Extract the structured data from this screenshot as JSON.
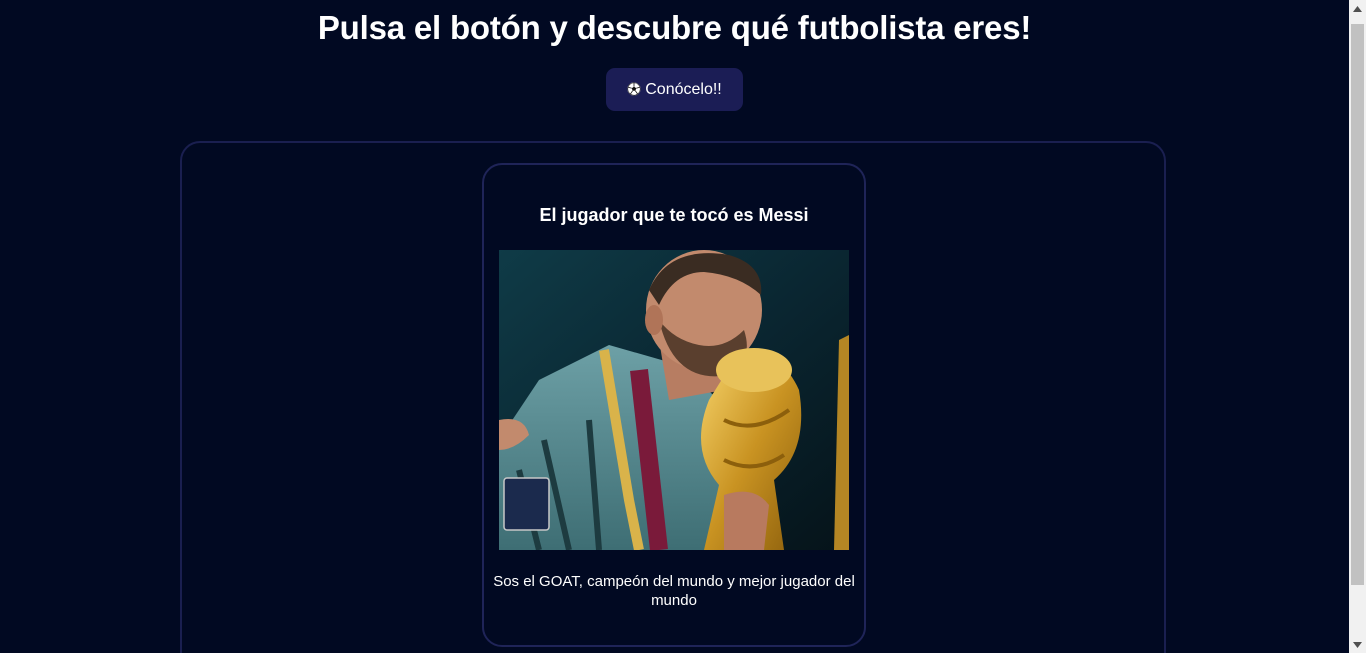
{
  "header": {
    "title": "Pulsa el botón y descubre qué futbolista eres!"
  },
  "reveal_button": {
    "icon": "soccer-ball-icon",
    "label": "Conócelo!!"
  },
  "player_card": {
    "title": "El jugador que te tocó es Messi",
    "image_alt": "Messi",
    "description": "Sos el GOAT, campeón del mundo y mejor jugador del mundo"
  },
  "colors": {
    "background": "#010922",
    "button": "#1b1d55",
    "panel_border": "#1a1f50",
    "text": "#ffffff"
  }
}
